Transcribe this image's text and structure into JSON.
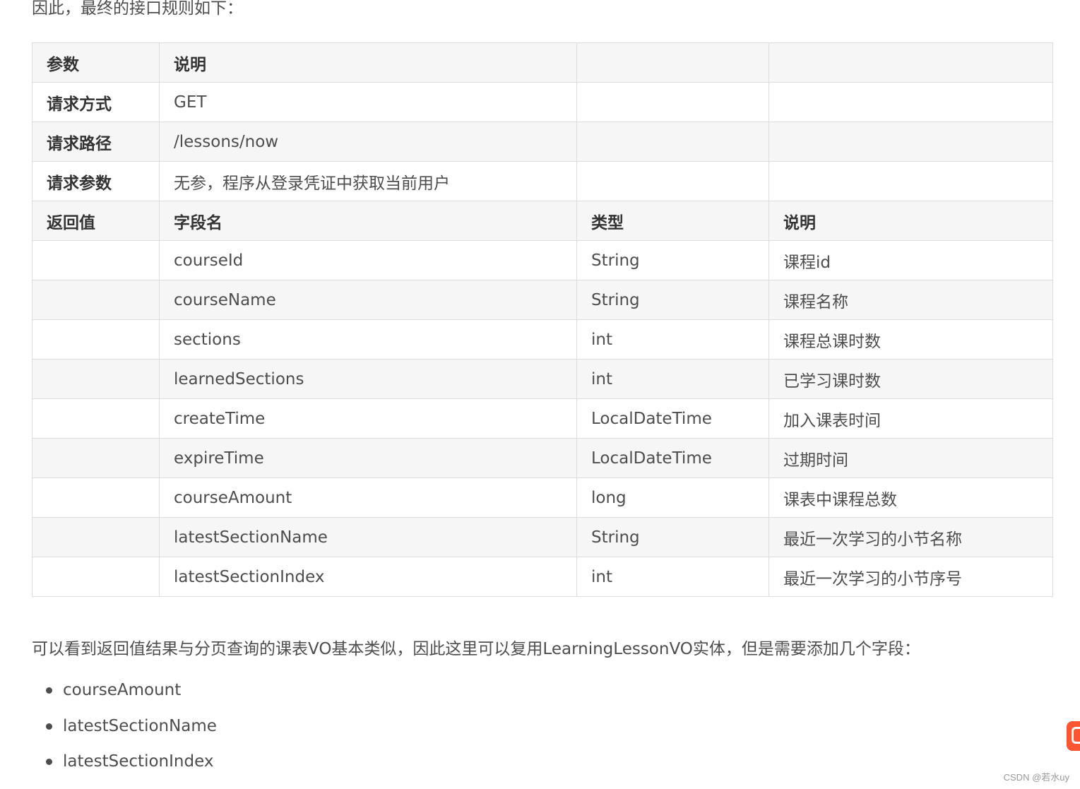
{
  "intro_text": "因此，最终的接口规则如下：",
  "api_table": {
    "header": [
      "参数",
      "说明",
      "",
      ""
    ],
    "request_rows": [
      {
        "param": "请求方式",
        "value": "GET"
      },
      {
        "param": "请求路径",
        "value": "/lessons/now"
      },
      {
        "param": "请求参数",
        "value": "无参，程序从登录凭证中获取当前用户"
      }
    ],
    "return_header": [
      "返回值",
      "字段名",
      "类型",
      "说明"
    ],
    "fields": [
      {
        "name": "courseId",
        "type": "String",
        "desc": "课程id"
      },
      {
        "name": "courseName",
        "type": "String",
        "desc": "课程名称"
      },
      {
        "name": "sections",
        "type": "int",
        "desc": "课程总课时数"
      },
      {
        "name": "learnedSections",
        "type": "int",
        "desc": "已学习课时数"
      },
      {
        "name": "createTime",
        "type": "LocalDateTime",
        "desc": "加入课表时间"
      },
      {
        "name": "expireTime",
        "type": "LocalDateTime",
        "desc": "过期时间"
      },
      {
        "name": "courseAmount",
        "type": "long",
        "desc": "课表中课程总数"
      },
      {
        "name": "latestSectionName",
        "type": "String",
        "desc": "最近一次学习的小节名称"
      },
      {
        "name": "latestSectionIndex",
        "type": "int",
        "desc": "最近一次学习的小节序号"
      }
    ]
  },
  "summary_text": "可以看到返回值结果与分页查询的课表VO基本类似，因此这里可以复用LearningLessonVO实体，但是需要添加几个字段：",
  "bullet_list": [
    "courseAmount",
    "latestSectionName",
    "latestSectionIndex"
  ],
  "watermark": "CSDN @若水uy",
  "badge_icon": "csdn-logo-icon",
  "colors": {
    "text": "#4d4d4d",
    "header_bg": "#f6f6f6",
    "border": "#dddddd",
    "badge": "#fc5531"
  }
}
